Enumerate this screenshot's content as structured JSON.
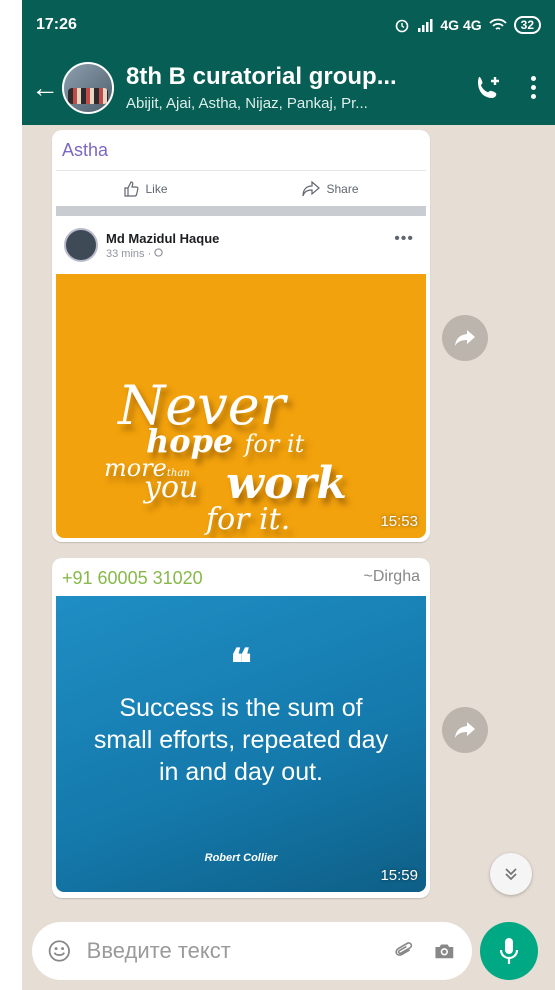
{
  "status_bar": {
    "time": "17:26",
    "network": "4G 4G",
    "battery": "32"
  },
  "header": {
    "title": "8th B curatorial group...",
    "members": "Abijit, Ajai, Astha, Nijaz, Pankaj, Pr..."
  },
  "messages": [
    {
      "sender": "Astha",
      "sender_color": "#7c68c4",
      "facebook_share": {
        "like_label": "Like",
        "share_label": "Share",
        "author": "Md Mazidul Haque",
        "meta": "33 mins · ",
        "quote_lines": [
          "Never",
          "hope",
          "for it",
          "more",
          "than",
          "you",
          "work",
          "for it."
        ]
      },
      "time": "15:53"
    },
    {
      "sender": "+91 60005 31020",
      "sender_color": "#86b94a",
      "alias": "~Dirgha",
      "quote_mark": "❝",
      "quote_text": "Success is the sum of small efforts, repeated day in and day out.",
      "quote_author": "Robert Collier",
      "time": "15:59"
    }
  ],
  "input": {
    "placeholder": "Введите текст"
  },
  "colors": {
    "header": "#075e54",
    "chat_bg": "#e6ddd4",
    "mic_button": "#00a884"
  }
}
